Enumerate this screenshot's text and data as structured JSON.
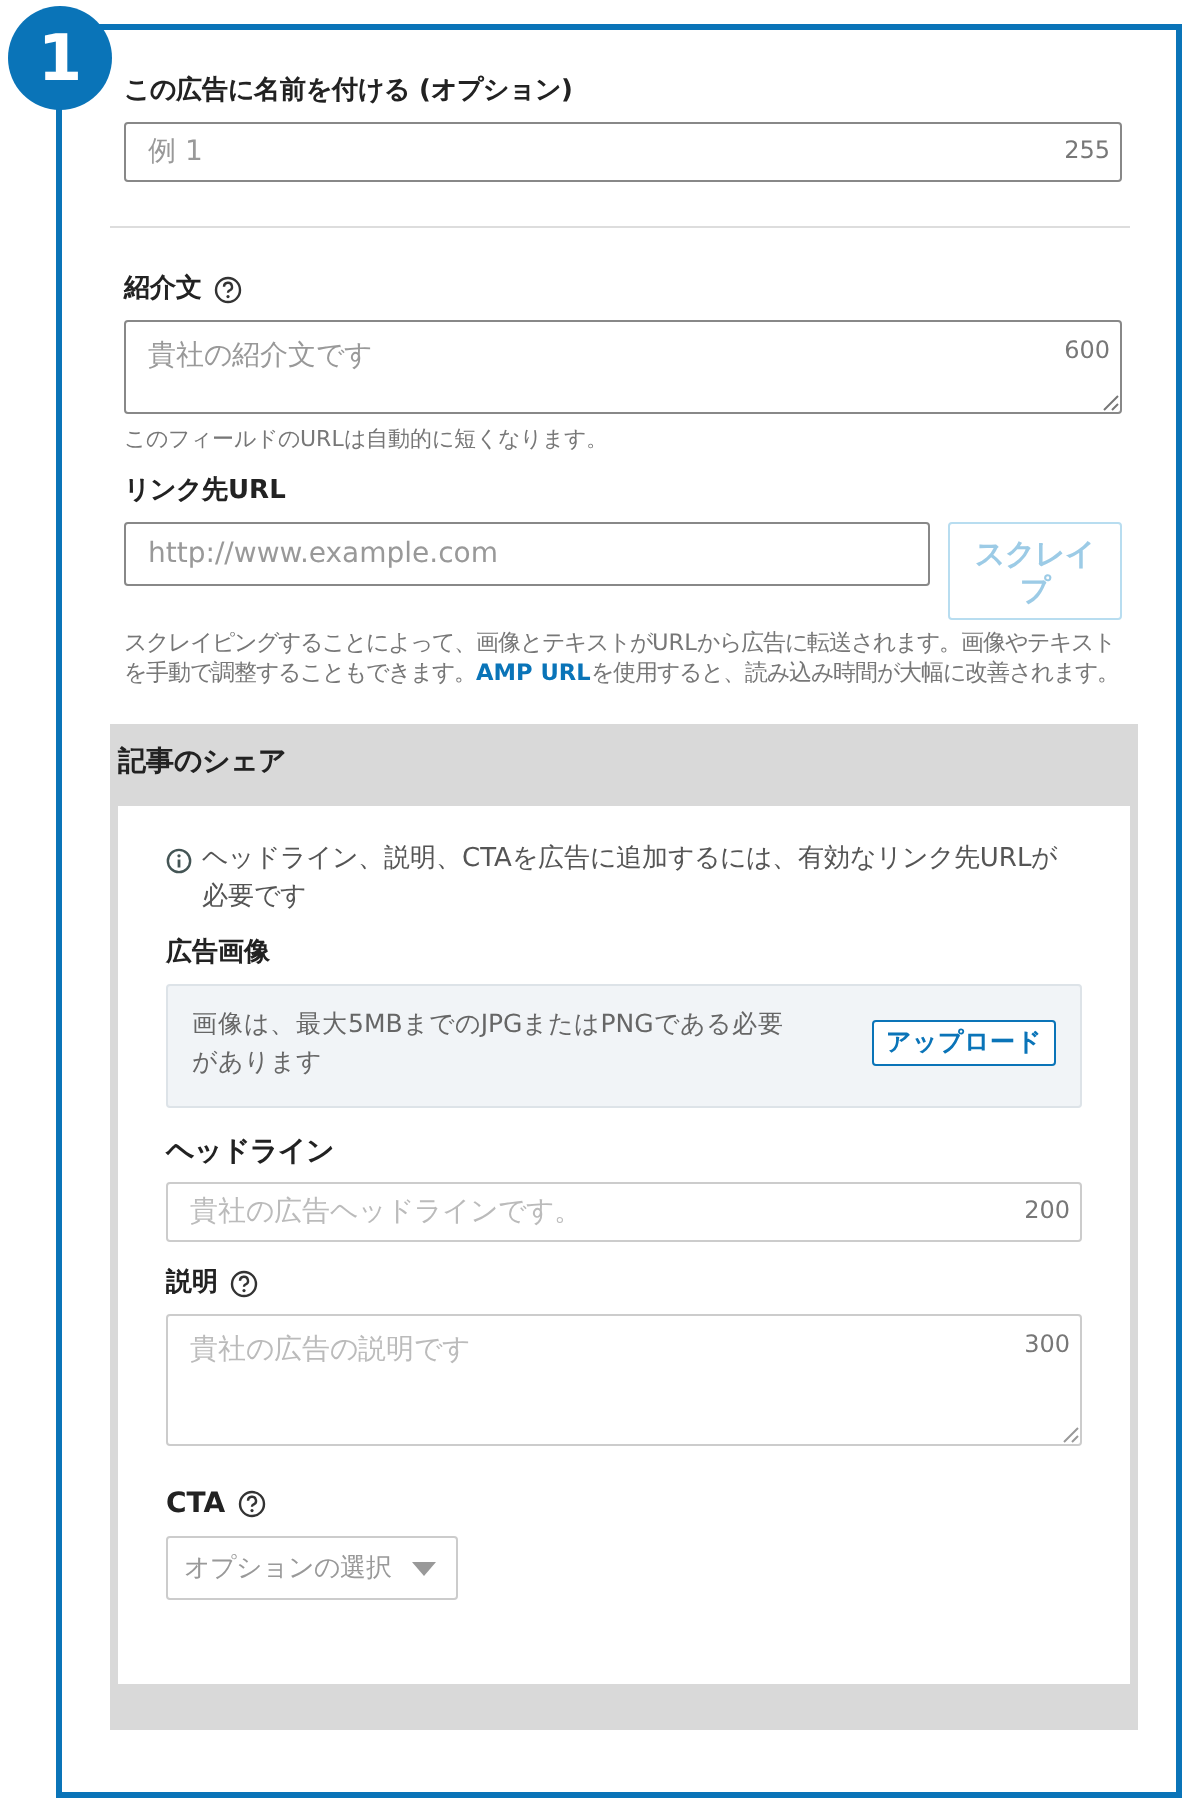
{
  "step_badge": "1",
  "name_field": {
    "label": "この広告に名前を付ける (オプション)",
    "placeholder": "例 1",
    "counter": "255"
  },
  "intro_field": {
    "label": "紹介文",
    "placeholder": "貴社の紹介文です",
    "counter": "600",
    "hint": "このフィールドのURLは自動的に短くなります。"
  },
  "url_field": {
    "label": "リンク先URL",
    "placeholder": "http://www.example.com",
    "button": {
      "label": "スクレイプ",
      "disabled": true
    },
    "help_before": "スクレイピングすることによって、画像とテキストがURLから広告に転送されます。画像やテキストを手動で調整することもできます。",
    "help_link": "AMP URL",
    "help_after": "を使用すると、読み込み時間が大幅に改善されます。"
  },
  "article_share": {
    "title": "記事のシェア",
    "notice": "ヘッドライン、説明、CTAを広告に追加するには、有効なリンク先URLが必要です",
    "image": {
      "label": "広告画像",
      "text": "画像は、最大5MBまでのJPGまたはPNGである必要があります",
      "button": "アップロード"
    },
    "headline": {
      "label": "ヘッドライン",
      "placeholder": "貴社の広告ヘッドラインです。",
      "counter": "200"
    },
    "description": {
      "label": "説明",
      "placeholder": "貴社の広告の説明です",
      "counter": "300"
    },
    "cta": {
      "label": "CTA",
      "placeholder": "オプションの選択"
    }
  }
}
